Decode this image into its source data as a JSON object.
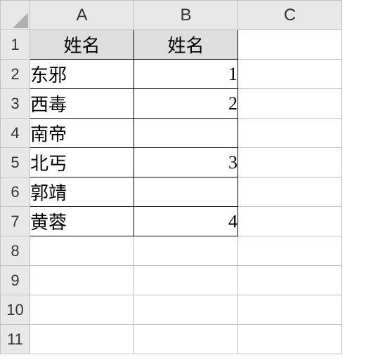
{
  "columns": {
    "A": "A",
    "B": "B",
    "C": "C"
  },
  "rows": {
    "r1": "1",
    "r2": "2",
    "r3": "3",
    "r4": "4",
    "r5": "5",
    "r6": "6",
    "r7": "7",
    "r8": "8",
    "r9": "9",
    "r10": "10",
    "r11": "11"
  },
  "headers": {
    "A1": "姓名",
    "B1": "姓名"
  },
  "dataA": {
    "r2": "东邪",
    "r3": "西毒",
    "r4": "南帝",
    "r5": "北丐",
    "r6": "郭靖",
    "r7": "黄蓉"
  },
  "dataB": {
    "r2": "1",
    "r3": "2",
    "r4": "",
    "r5": "3",
    "r6": "",
    "r7": "4"
  },
  "chart_data": {
    "type": "table",
    "columns": [
      "姓名",
      "姓名"
    ],
    "rows": [
      [
        "东邪",
        1
      ],
      [
        "西毒",
        2
      ],
      [
        "南帝",
        null
      ],
      [
        "北丐",
        3
      ],
      [
        "郭靖",
        null
      ],
      [
        "黄蓉",
        4
      ]
    ]
  }
}
